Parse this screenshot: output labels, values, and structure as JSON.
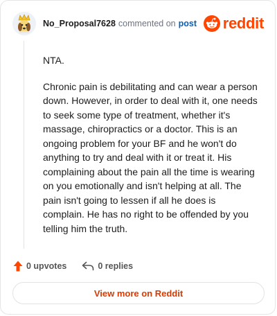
{
  "header": {
    "username": "No_Proposal7628",
    "action_text": "commented on",
    "post_link": "post",
    "brand_word": "reddit"
  },
  "comment": {
    "paragraphs": [
      "NTA.",
      "Chronic pain is debilitating and can wear a person down. However, in order to deal with it, one needs to seek some type of treatment, whether it's massage, chiropractics or a doctor. This is an ongoing problem for your BF and he won't do anything to try and deal with it or treat it. His complaining about the pain all the time is wearing on you emotionally and isn't helping at all. The pain isn't going to lessen if all he does is complain. He has no right to be offended by you telling him the truth."
    ]
  },
  "actions": {
    "upvotes_label": "0 upvotes",
    "replies_label": "0 replies"
  },
  "footer": {
    "view_label": "View more on Reddit"
  },
  "colors": {
    "brand": "#ff4500",
    "link": "#0a5fb4",
    "button_text": "#d93a00"
  },
  "icons": [
    "avatar",
    "reddit-logo-icon",
    "upvote-arrow-icon",
    "reply-arrow-icon"
  ]
}
